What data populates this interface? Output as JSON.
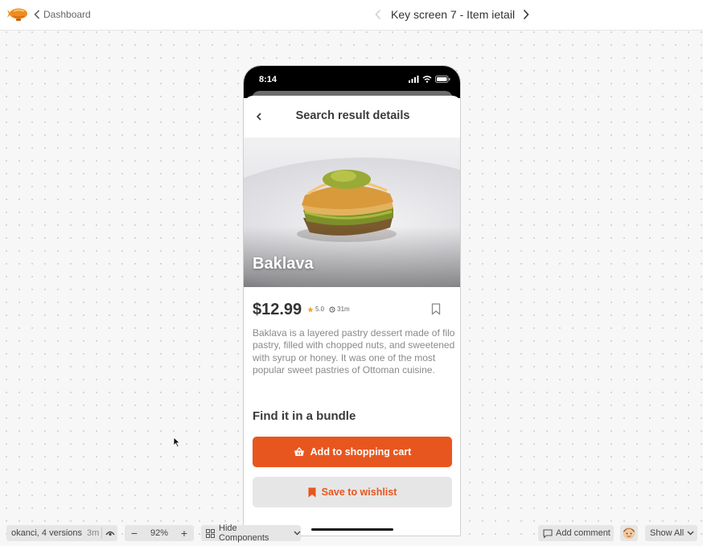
{
  "topbar": {
    "back_label": "Dashboard",
    "screen_title": "Key screen 7 - Item ietail"
  },
  "phone": {
    "status_time": "8:14",
    "header_title": "Search result details",
    "item": {
      "name": "Baklava",
      "price": "$12.99",
      "rating": "5.0",
      "time": "31m",
      "description": "Baklava is a layered pastry dessert made of filo pastry, filled with chopped nuts, and sweetened with syrup or honey. It was one of the most popular sweet pastries of Ottoman cuisine."
    },
    "section_title": "Find it in a bundle",
    "primary_button": "Add to shopping cart",
    "secondary_button": "Save to wishlist"
  },
  "toolbar": {
    "versions_label": "okanci, 4 versions",
    "versions_ago": "3m",
    "zoom_value": "92%",
    "zoom_minus": "−",
    "zoom_plus": "+",
    "components_label": "Hide Components",
    "comment_label": "Add comment",
    "show_all_label": "Show All"
  },
  "colors": {
    "accent": "#e8561f",
    "star": "#f5a623",
    "secondary_button_bg": "#e6e6e6"
  },
  "icons": [
    "zeppelin-logo-icon",
    "chevron-left-icon",
    "chevron-right-icon",
    "signal-icon",
    "wifi-icon",
    "battery-icon",
    "star-icon",
    "clock-icon",
    "bookmark-icon",
    "basket-icon",
    "eye-icon",
    "components-icon",
    "comment-icon",
    "avatar-icon",
    "chevron-down-icon",
    "cursor-icon"
  ]
}
